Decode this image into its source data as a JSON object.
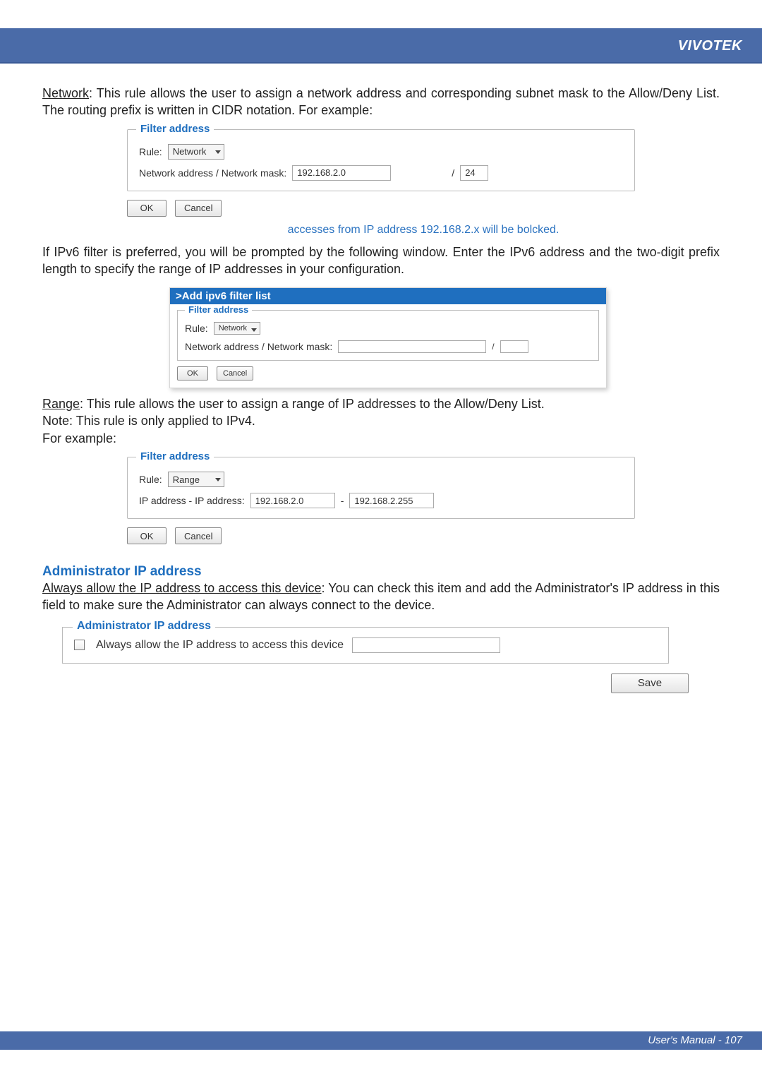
{
  "header": {
    "brand": "VIVOTEK"
  },
  "footer": {
    "text": "User's Manual - 107"
  },
  "network": {
    "label": "Network",
    "desc": ": This rule allows the user to assign a network address and corresponding subnet mask to the Allow/Deny List. The routing prefix is written in CIDR notation. For example:"
  },
  "fig_network": {
    "legend": "Filter address",
    "rule_label": "Rule:",
    "rule_value": "Network",
    "addr_label": "Network address / Network mask:",
    "addr_value": "192.168.2.0",
    "slash": "/",
    "mask_value": "24",
    "ok": "OK",
    "cancel": "Cancel",
    "caption": "accesses from IP address 192.168.2.x will be bolcked."
  },
  "ipv6_para": "If IPv6 filter is preferred, you will be prompted by the following window. Enter the IPv6 address and the two-digit prefix length to specify the range of IP addresses in your configuration.",
  "fig_ipv6": {
    "title": ">Add ipv6 filter list",
    "legend": "Filter address",
    "rule_label": "Rule:",
    "rule_value": "Network",
    "addr_label": "Network address / Network mask:",
    "addr_value": "",
    "slash": "/",
    "mask_value": "",
    "ok": "OK",
    "cancel": "Cancel"
  },
  "range": {
    "label": "Range",
    "desc": ": This rule allows the user to assign a range of IP addresses to the Allow/Deny List.",
    "note": "Note: This rule is only applied to IPv4.",
    "example": "For example:"
  },
  "fig_range": {
    "legend": "Filter address",
    "rule_label": "Rule:",
    "rule_value": "Range",
    "addr_label": "IP address - IP address:",
    "from_value": "192.168.2.0",
    "dash": "-",
    "to_value": "192.168.2.255",
    "ok": "OK",
    "cancel": "Cancel"
  },
  "admin": {
    "heading": "Administrator IP address",
    "label": "Always allow the IP address to access this device",
    "desc": ": You can check this item and add the Administrator's IP address in this field to make sure the Administrator can always connect to the device.",
    "legend": "Administrator IP address",
    "checkbox_label": "Always allow the IP address to access this device",
    "input_value": "",
    "save": "Save"
  }
}
